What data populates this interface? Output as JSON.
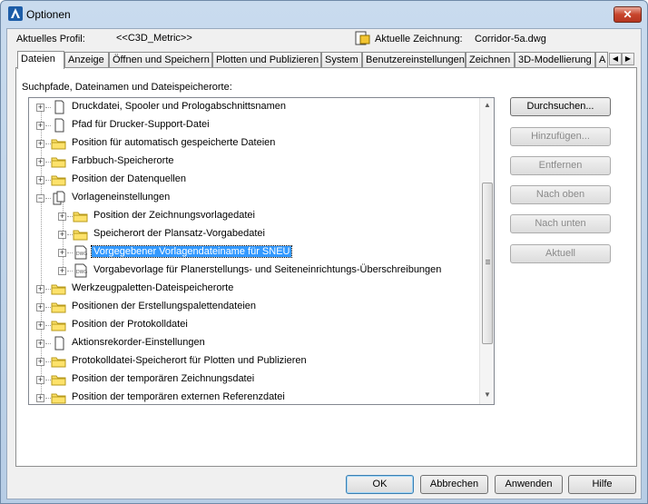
{
  "window": {
    "title": "Optionen",
    "close_label": "✕"
  },
  "header": {
    "profile_label": "Aktuelles Profil:",
    "profile_value": "<<C3D_Metric>>",
    "drawing_label": "Aktuelle Zeichnung:",
    "drawing_value": "Corridor-5a.dwg"
  },
  "tabs": [
    "Dateien",
    "Anzeige",
    "Öffnen und Speichern",
    "Plotten und Publizieren",
    "System",
    "Benutzereinstellungen",
    "Zeichnen",
    "3D-Modellierung",
    "A"
  ],
  "active_tab": "Dateien",
  "panel": {
    "caption": "Suchpfade, Dateinamen und Dateispeicherorte:"
  },
  "tree": [
    {
      "label": "Druckdatei, Spooler und Prologabschnittsnamen",
      "icon": "document-icon",
      "level": 0
    },
    {
      "label": "Pfad für Drucker-Support-Datei",
      "icon": "document-icon",
      "level": 0
    },
    {
      "label": "Position für automatisch gespeicherte Dateien",
      "icon": "folder-icon",
      "level": 0
    },
    {
      "label": "Farbbuch-Speicherorte",
      "icon": "folder-icon",
      "level": 0
    },
    {
      "label": "Position der Datenquellen",
      "icon": "folder-icon",
      "level": 0
    },
    {
      "label": "Vorlageneinstellungen",
      "icon": "documents-icon",
      "level": 0,
      "expanded": true
    },
    {
      "label": "Position der Zeichnungsvorlagedatei",
      "icon": "folder-icon",
      "level": 1
    },
    {
      "label": "Speicherort der Plansatz-Vorgabedatei",
      "icon": "folder-icon",
      "level": 1
    },
    {
      "label": "Vorgegebener Vorlagendateiname für SNEU",
      "icon": "dwg-file-icon",
      "level": 1,
      "selected": true
    },
    {
      "label": "Vorgabevorlage für Planerstellungs- und Seiteneinrichtungs-Überschreibungen",
      "icon": "dwg-file-icon",
      "level": 1
    },
    {
      "label": "Werkzeugpaletten-Dateispeicherorte",
      "icon": "folder-icon",
      "level": 0
    },
    {
      "label": "Positionen der Erstellungspalettendateien",
      "icon": "folder-icon",
      "level": 0
    },
    {
      "label": "Position der Protokolldatei",
      "icon": "folder-icon",
      "level": 0
    },
    {
      "label": "Aktionsrekorder-Einstellungen",
      "icon": "document-icon",
      "level": 0
    },
    {
      "label": "Protokolldatei-Speicherort für Plotten und Publizieren",
      "icon": "folder-icon",
      "level": 0
    },
    {
      "label": "Position der temporären Zeichnungsdatei",
      "icon": "folder-icon",
      "level": 0
    },
    {
      "label": "Position der temporären externen Referenzdatei",
      "icon": "folder-icon",
      "level": 0
    }
  ],
  "side_buttons": [
    {
      "label": "Durchsuchen...",
      "enabled": true
    },
    {
      "label": "Hinzufügen...",
      "enabled": false
    },
    {
      "label": "Entfernen",
      "enabled": false
    },
    {
      "label": "Nach oben",
      "enabled": false
    },
    {
      "label": "Nach unten",
      "enabled": false
    },
    {
      "label": "Aktuell",
      "enabled": false
    }
  ],
  "bottom_buttons": {
    "ok": "OK",
    "cancel": "Abbrechen",
    "apply": "Anwenden",
    "help": "Hilfe"
  },
  "colors": {
    "selection": "#3399ff",
    "folder": "#fde26b",
    "close": "#c8452c"
  }
}
